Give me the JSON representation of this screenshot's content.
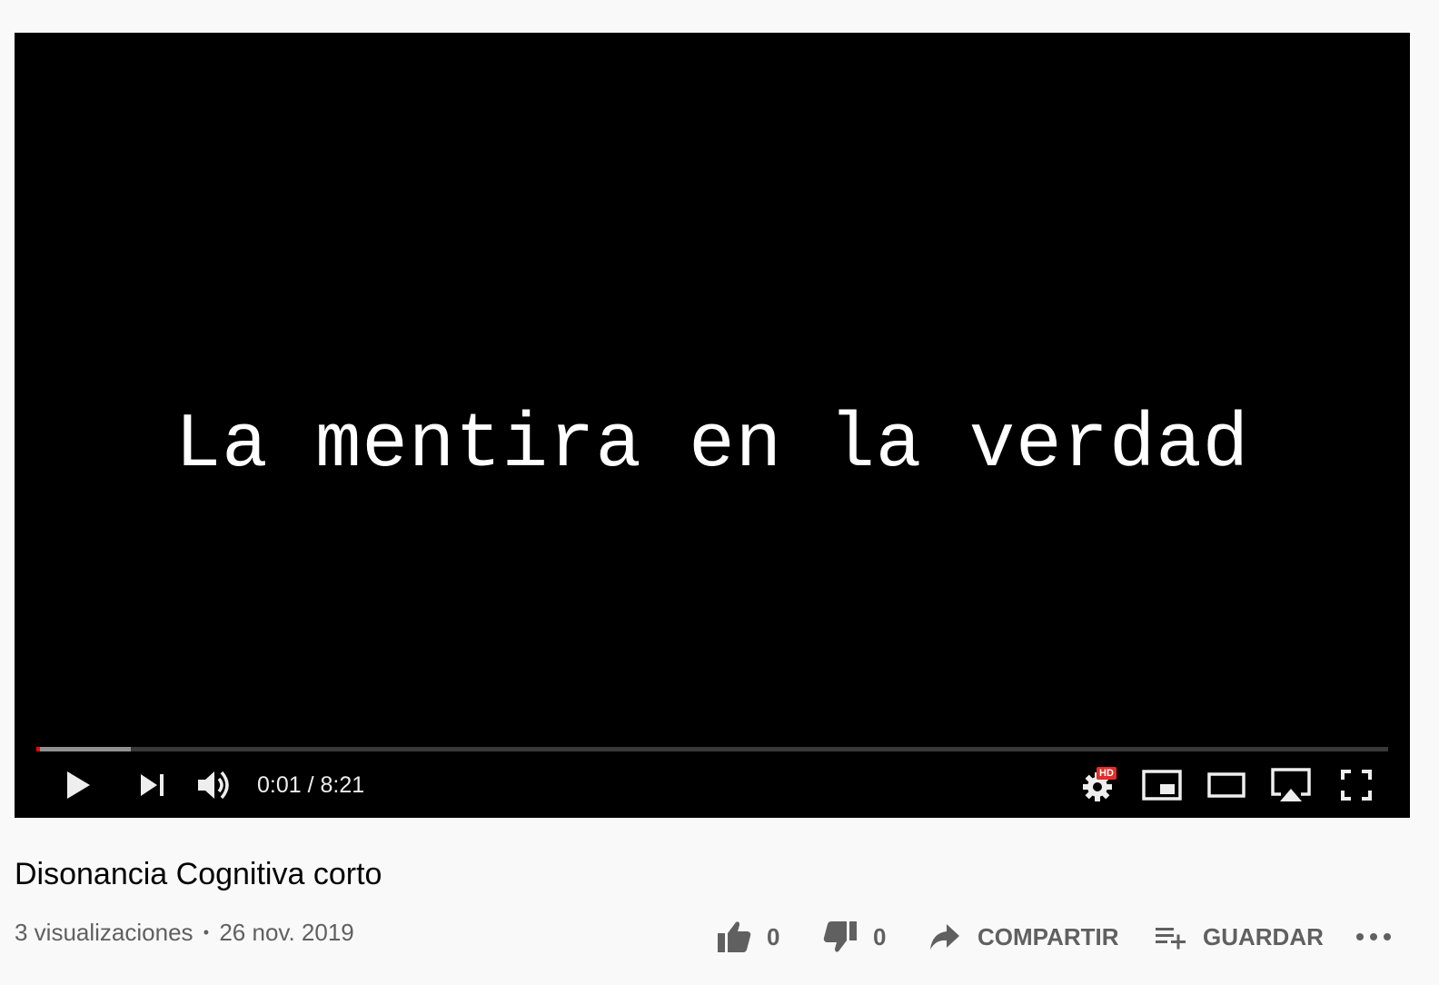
{
  "player": {
    "frame_text": "La mentira en la verdad",
    "time_current": "0:01",
    "time_separator": " / ",
    "time_total": "8:21",
    "progress_played_fraction": 0.003,
    "progress_loaded_fraction": 0.07,
    "progress_color": "#ff0000",
    "hd_badge": "HD",
    "hd_badge_color": "#e52d27",
    "icons": [
      "play-icon",
      "next-icon",
      "volume-icon",
      "settings-icon",
      "miniplayer-icon",
      "theater-icon",
      "airplay-icon",
      "fullscreen-icon"
    ]
  },
  "video": {
    "title": "Disonancia Cognitiva corto",
    "views": "3 visualizaciones",
    "separator": "•",
    "date": "26 nov. 2019"
  },
  "actions": {
    "like_count": "0",
    "dislike_count": "0",
    "share_label": "COMPARTIR",
    "save_label": "GUARDAR",
    "icons": [
      "thumb-up-icon",
      "thumb-down-icon",
      "share-icon",
      "playlist-add-icon",
      "more-icon"
    ]
  },
  "colors": {
    "page_background": "#f9f9f9",
    "text_primary": "#030303",
    "text_secondary": "#606060",
    "player_background": "#000000"
  }
}
